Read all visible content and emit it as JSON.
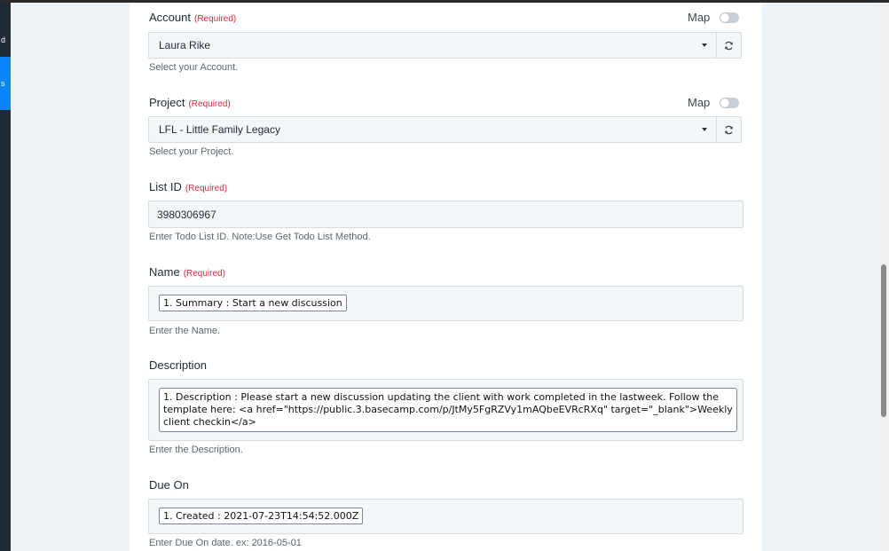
{
  "sidebar": {
    "item_a_label": "d",
    "item_b_label": "s"
  },
  "form": {
    "account": {
      "label": "Account",
      "required": "(Required)",
      "map_label": "Map",
      "value": "Laura Rike",
      "help": "Select your Account."
    },
    "project": {
      "label": "Project",
      "required": "(Required)",
      "map_label": "Map",
      "value": "LFL - Little Family Legacy",
      "help": "Select your Project."
    },
    "list_id": {
      "label": "List ID",
      "required": "(Required)",
      "value": "3980306967",
      "help": "Enter Todo List ID. Note:Use Get Todo List Method."
    },
    "name": {
      "label": "Name",
      "required": "(Required)",
      "chip": "1. Summary : Start a new discussion",
      "help": "Enter the Name."
    },
    "description": {
      "label": "Description",
      "chip": "1. Description : Please start a new discussion updating the client with work completed in the lastweek. Follow the template here: <a href=\"https://public.3.basecamp.com/p/JtMy5FgRZVy1mAQbeEVRcRXq\" target=\"_blank\">Weekly client checkin</a>",
      "help": "Enter the Description."
    },
    "due_on": {
      "label": "Due On",
      "chip": "1. Created : 2021-07-23T14:54:52.000Z",
      "help": "Enter Due On date. ex: 2016-05-01"
    }
  },
  "colors": {
    "required": "#e0243b",
    "accent": "#0a84ff",
    "field_bg": "#f4f7fa"
  }
}
